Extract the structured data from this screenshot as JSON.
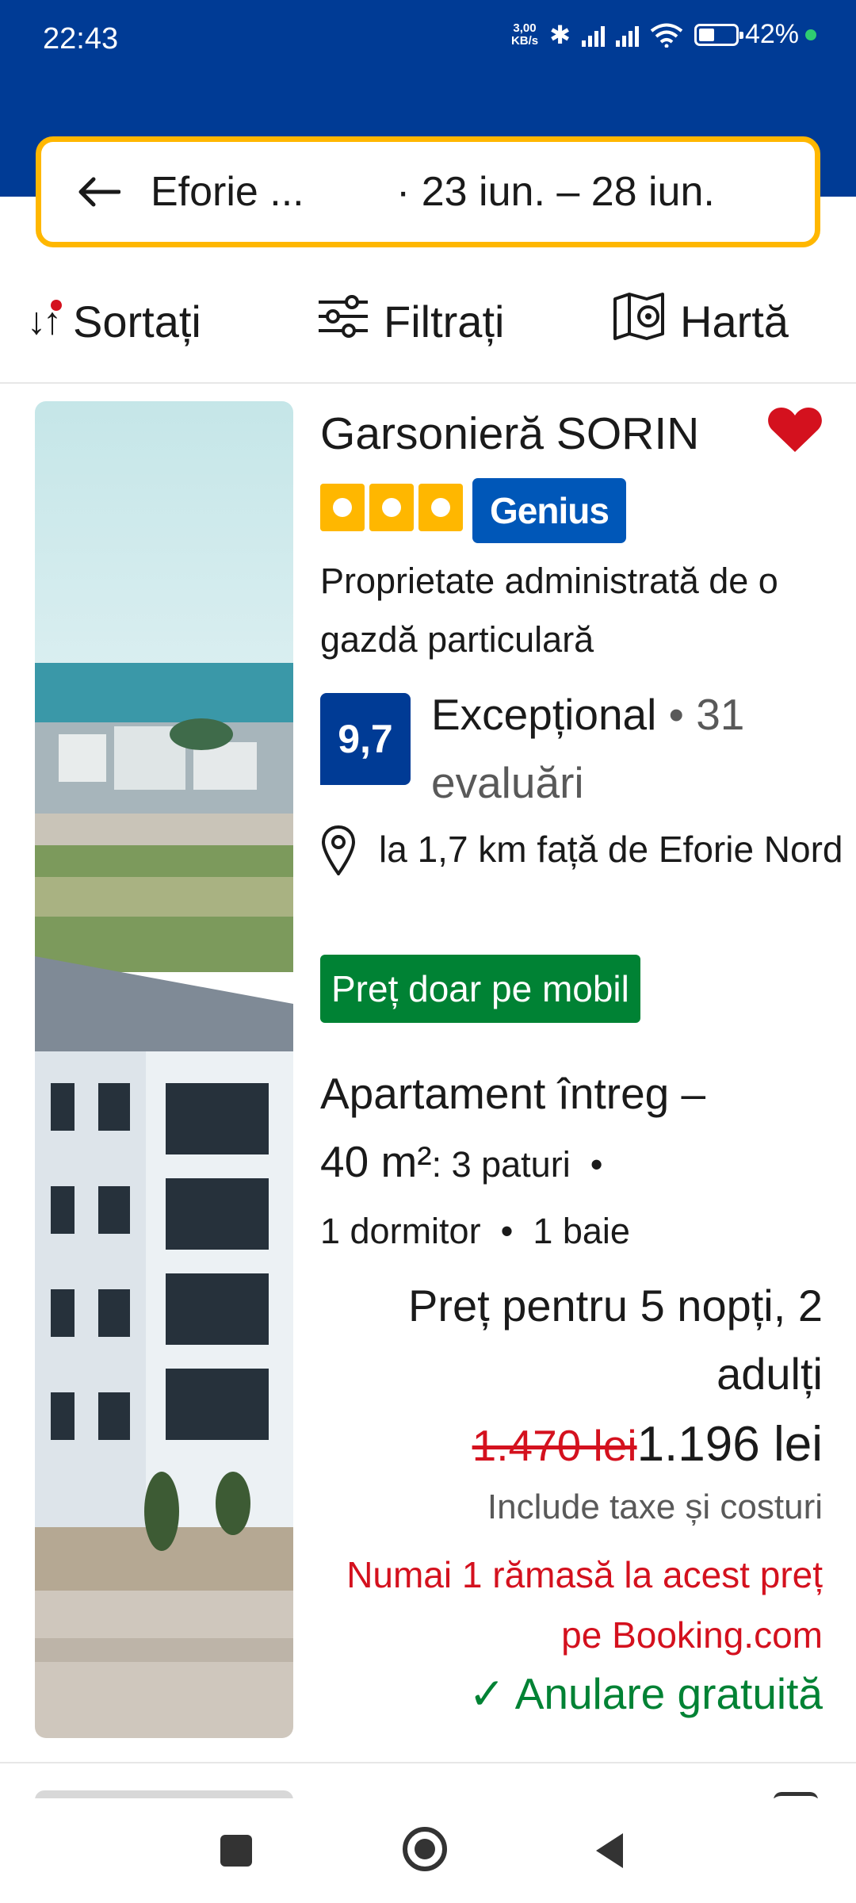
{
  "status_bar": {
    "time": "22:43",
    "net_speed_value": "3,00",
    "net_speed_unit": "KB/s",
    "battery_percent": "42%"
  },
  "search": {
    "destination": "Eforie ...",
    "dates": "· 23 iun. – 28 iun."
  },
  "toolbar": {
    "sort_label": "Sortați",
    "filter_label": "Filtrați",
    "map_label": "Hartă"
  },
  "listing": {
    "title": "Garsonieră SORIN",
    "star_rating": 3,
    "genius_label": "Genius",
    "host_type": "Proprietate administrată de o gazdă particulară",
    "score": "9,7",
    "score_label": "Excepțional",
    "reviews_count": "31",
    "reviews_label": "evaluări",
    "distance": "la 1,7 km față de Eforie Nord",
    "mobile_price_badge": "Preț doar pe mobil",
    "room_type": "Apartament întreg –",
    "room_size": "40 m²",
    "room_beds": ": 3 paturi",
    "room_extra_1": "1 dormitor",
    "room_extra_2": "1 baie",
    "price_label": "Preț pentru 5 nopți, 2 adulți",
    "old_price": "1.470 lei",
    "new_price": "1.196 lei",
    "taxes_note": "Include taxe și costuri",
    "scarcity_note": "Numai 1 rămasă la acest preț pe Booking.com",
    "free_cancellation": "Anulare gratuită",
    "favorite": true
  },
  "colors": {
    "brand_blue": "#003b95",
    "accent_yellow": "#ffb700",
    "genius_blue": "#0057b8",
    "price_red": "#d4111e",
    "success_green": "#008234"
  }
}
